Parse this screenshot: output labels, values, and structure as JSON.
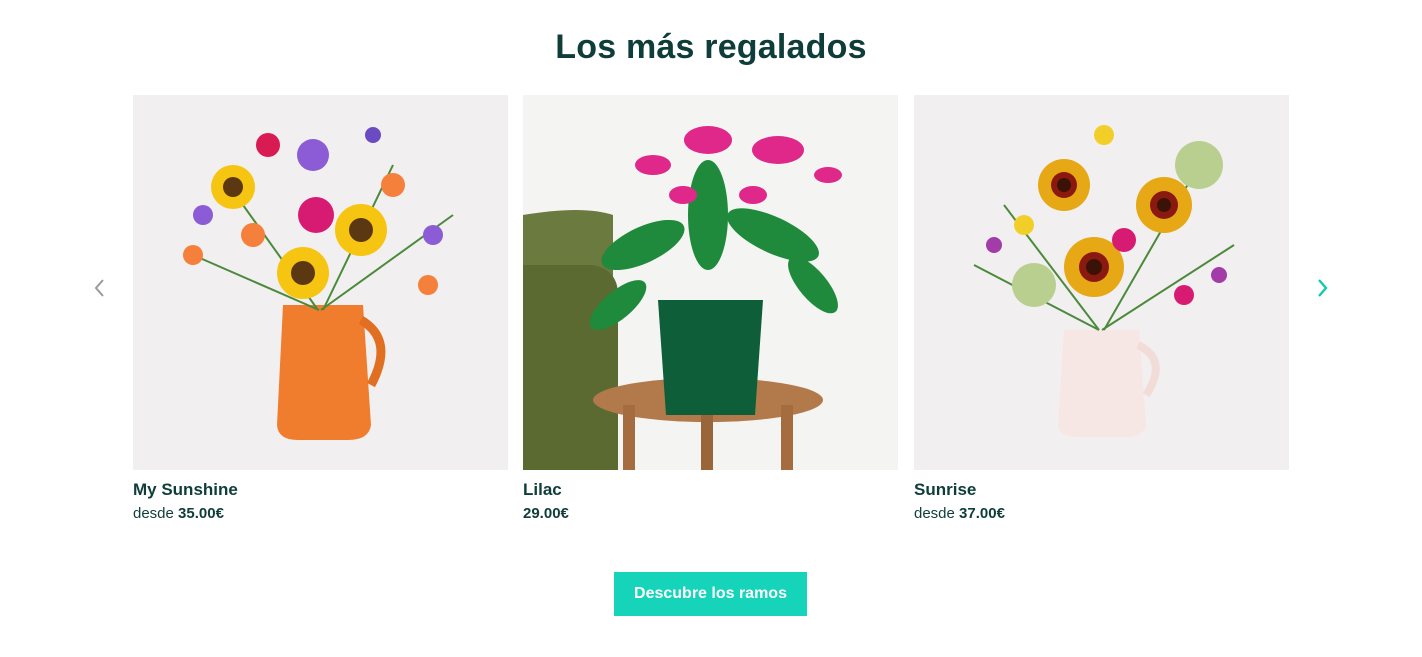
{
  "section": {
    "title": "Los más regalados"
  },
  "carousel": {
    "prev_icon": "chevron-left-icon",
    "next_icon": "chevron-right-icon",
    "products": [
      {
        "name": "My Sunshine",
        "from_label": "desde",
        "price": "35.00€"
      },
      {
        "name": "Lilac",
        "from_label": "",
        "price": "29.00€"
      },
      {
        "name": "Sunrise",
        "from_label": "desde",
        "price": "37.00€"
      }
    ]
  },
  "cta": {
    "label": "Descubre los ramos"
  },
  "colors": {
    "heading": "#0f3d3a",
    "accent": "#16d4b9",
    "card_bg": "#f2eff1"
  }
}
